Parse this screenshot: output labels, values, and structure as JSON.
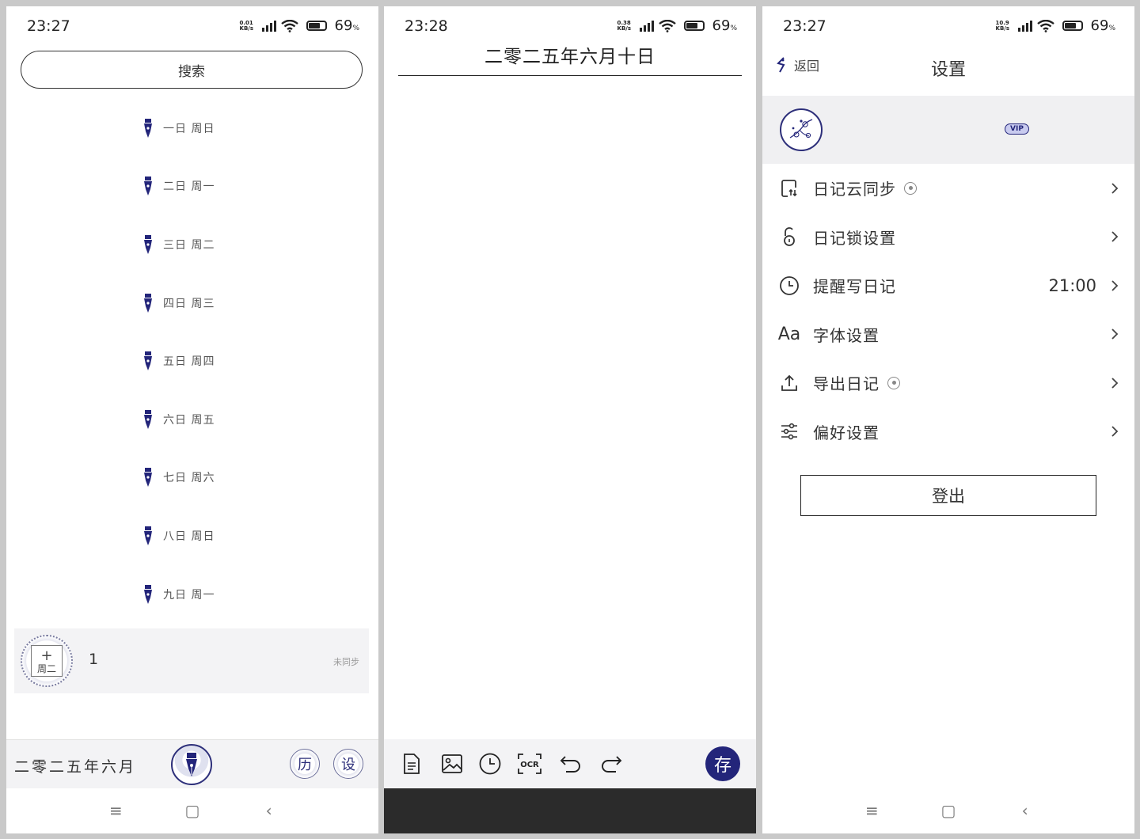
{
  "colors": {
    "accent": "#23257a",
    "toolbar_bg": "#f3f3f5",
    "divider": "#222222"
  },
  "screen_list": {
    "status": {
      "time": "23:27",
      "speed_top": "0.01",
      "speed_bottom": "KB/s",
      "battery": "69",
      "battery_unit": "%"
    },
    "search_label": "搜索",
    "days": [
      {
        "label": "一日 周日"
      },
      {
        "label": "二日 周一"
      },
      {
        "label": "三日 周二"
      },
      {
        "label": "四日 周三"
      },
      {
        "label": "五日 周四"
      },
      {
        "label": "六日 周五"
      },
      {
        "label": "七日 周六"
      },
      {
        "label": "八日 周日"
      },
      {
        "label": "九日 周一"
      }
    ],
    "entry": {
      "plus": "+",
      "weekday": "周二",
      "count": "1",
      "sync_status": "未同步"
    },
    "bottom": {
      "month_label": "二零二五年六月",
      "history_label": "历",
      "settings_label": "设"
    },
    "nav": {
      "menu": "≡",
      "home": "▢",
      "back": "‹"
    }
  },
  "screen_editor": {
    "status": {
      "time": "23:28",
      "speed_top": "0.38",
      "speed_bottom": "KB/s",
      "battery": "69",
      "battery_unit": "%"
    },
    "date_title": "二零二五年六月十日",
    "toolbar": {
      "ocr_label": "OCR",
      "save_label": "存"
    }
  },
  "screen_settings": {
    "status": {
      "time": "23:27",
      "speed_top": "10.9",
      "speed_bottom": "KB/s",
      "battery": "69",
      "battery_unit": "%"
    },
    "back_label": "返回",
    "title": "设置",
    "vip_label": "VIP",
    "items": [
      {
        "label": "日记云同步",
        "icon": "cloud-sync-icon",
        "value": ""
      },
      {
        "label": "日记锁设置",
        "icon": "lock-icon",
        "value": ""
      },
      {
        "label": "提醒写日记",
        "icon": "clock-icon",
        "value": "21:00"
      },
      {
        "label": "字体设置",
        "icon": "font-icon",
        "icon_text": "Aa",
        "value": ""
      },
      {
        "label": "导出日记",
        "icon": "export-icon",
        "value": ""
      },
      {
        "label": "偏好设置",
        "icon": "sliders-icon",
        "value": ""
      }
    ],
    "logout_label": "登出",
    "nav": {
      "menu": "≡",
      "home": "▢",
      "back": "‹"
    }
  }
}
